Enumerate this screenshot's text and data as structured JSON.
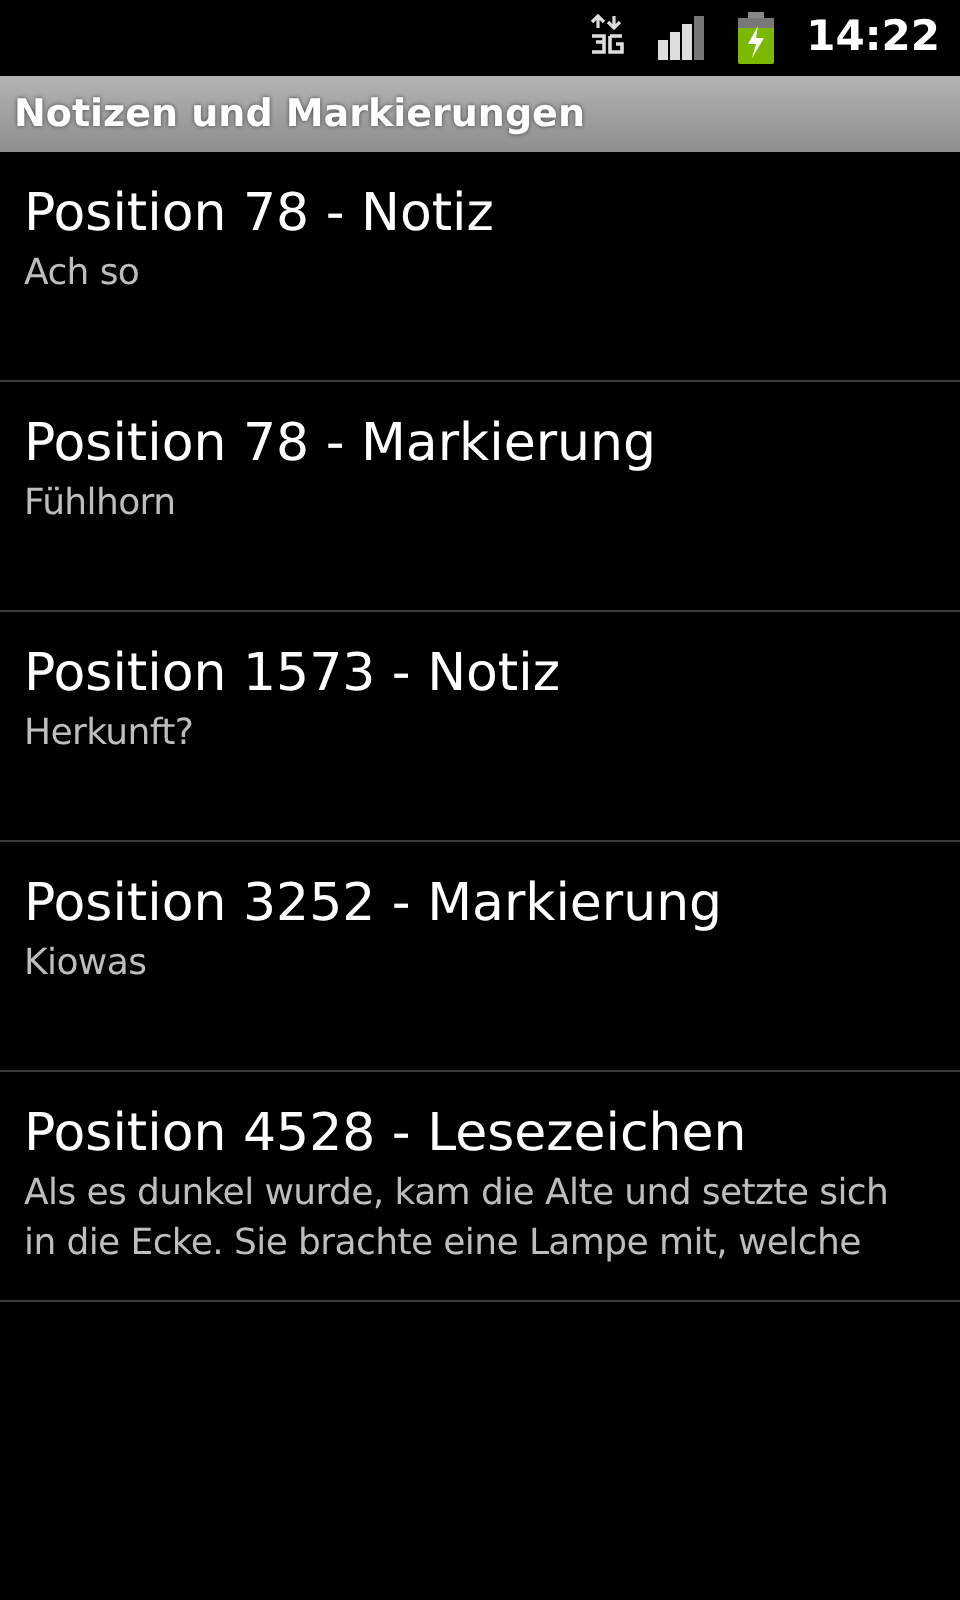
{
  "status_bar": {
    "time": "14:22"
  },
  "title_bar": {
    "title": "Notizen und Markierungen"
  },
  "entries": [
    {
      "title": "Position 78 - Notiz",
      "text": "Ach so"
    },
    {
      "title": "Position 78 - Markierung",
      "text": "Fühlhorn"
    },
    {
      "title": "Position 1573 - Notiz",
      "text": "Herkunft?"
    },
    {
      "title": "Position 3252 - Markierung",
      "text": "Kiowas"
    },
    {
      "title": "Position 4528 - Lesezeichen",
      "text": "Als es dunkel wurde, kam die Alte und setzte sich in die Ecke. Sie brachte eine Lampe mit, welche"
    }
  ]
}
